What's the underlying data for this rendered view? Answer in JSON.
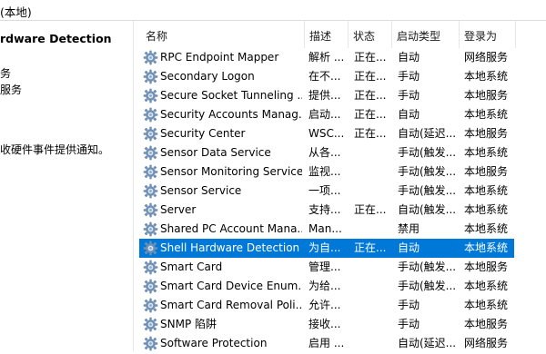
{
  "window": {
    "title": "(本地)"
  },
  "left_pane": {
    "service_name": "rdware Detection",
    "links": [
      "务",
      "服务"
    ],
    "description": "收硬件事件提供通知。"
  },
  "columns": [
    "名称",
    "描述",
    "状态",
    "启动类型",
    "登录为"
  ],
  "rows": [
    {
      "name": "RPC Endpoint Mapper",
      "desc": "解析 ...",
      "status": "正在...",
      "startup": "自动",
      "logon": "网络服务"
    },
    {
      "name": "Secondary Logon",
      "desc": "在不...",
      "status": "正在...",
      "startup": "手动",
      "logon": "本地系统"
    },
    {
      "name": "Secure Socket Tunneling ...",
      "desc": "提供...",
      "status": "正在...",
      "startup": "手动",
      "logon": "本地服务"
    },
    {
      "name": "Security Accounts Manag...",
      "desc": "启动...",
      "status": "正在...",
      "startup": "自动",
      "logon": "本地系统"
    },
    {
      "name": "Security Center",
      "desc": "WSC...",
      "status": "正在...",
      "startup": "自动(延迟...",
      "logon": "本地服务"
    },
    {
      "name": "Sensor Data Service",
      "desc": "从各...",
      "status": "",
      "startup": "手动(触发...",
      "logon": "本地系统"
    },
    {
      "name": "Sensor Monitoring Service",
      "desc": "监视...",
      "status": "",
      "startup": "手动(触发...",
      "logon": "本地服务"
    },
    {
      "name": "Sensor Service",
      "desc": "一项...",
      "status": "",
      "startup": "手动(触发...",
      "logon": "本地系统"
    },
    {
      "name": "Server",
      "desc": "支持...",
      "status": "正在...",
      "startup": "自动(触发...",
      "logon": "本地系统"
    },
    {
      "name": "Shared PC Account Mana...",
      "desc": "Man...",
      "status": "",
      "startup": "禁用",
      "logon": "本地系统"
    },
    {
      "name": "Shell Hardware Detection",
      "desc": "为自...",
      "status": "正在...",
      "startup": "自动",
      "logon": "本地系统",
      "selected": true
    },
    {
      "name": "Smart Card",
      "desc": "管理...",
      "status": "",
      "startup": "手动(触发...",
      "logon": "本地服务"
    },
    {
      "name": "Smart Card Device Enum...",
      "desc": "为给...",
      "status": "",
      "startup": "手动(触发...",
      "logon": "本地系统"
    },
    {
      "name": "Smart Card Removal Poli...",
      "desc": "允许...",
      "status": "",
      "startup": "手动",
      "logon": "本地系统"
    },
    {
      "name": "SNMP 陷阱",
      "desc": "接收...",
      "status": "",
      "startup": "手动",
      "logon": "本地服务"
    },
    {
      "name": "Software Protection",
      "desc": "启用 ...",
      "status": "",
      "startup": "自动(延迟...",
      "logon": "网络服务"
    }
  ],
  "colors": {
    "selection": "#0078d7",
    "selection_text": "#ffffff",
    "icon": "gear-icon"
  }
}
